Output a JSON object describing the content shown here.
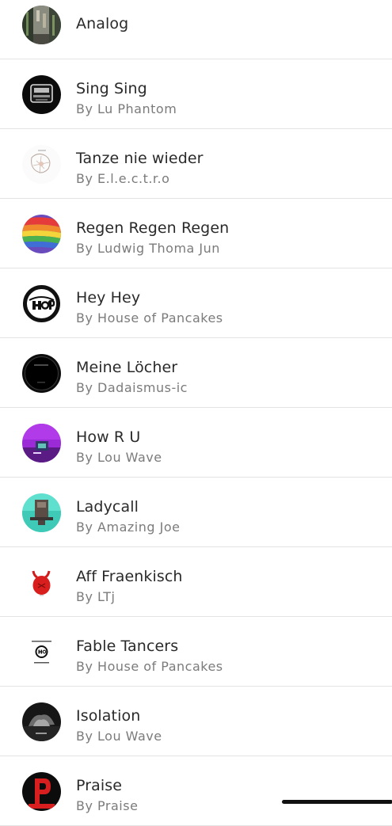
{
  "songs": [
    {
      "title": "Analog",
      "artist": "",
      "art": "photo-street-icon"
    },
    {
      "title": "Sing Sing",
      "artist": "By Lu Phantom",
      "art": "black-logo-icon"
    },
    {
      "title": "Tanze nie wieder",
      "artist": "By E.l.e.c.t.r.o",
      "art": "sketch-icon"
    },
    {
      "title": "Regen Regen Regen",
      "artist": "By Ludwig Thoma Jun",
      "art": "rainbow-flag-icon"
    },
    {
      "title": "Hey Hey",
      "artist": "By House of Pancakes",
      "art": "hop-logo-icon"
    },
    {
      "title": "Meine Löcher",
      "artist": "By Dadaismus-ic",
      "art": "black-disc-icon"
    },
    {
      "title": "How R U",
      "artist": "By Lou Wave",
      "art": "purple-cover-icon"
    },
    {
      "title": "Ladycall",
      "artist": "By Amazing Joe",
      "art": "teal-cover-icon"
    },
    {
      "title": "Aff Fraenkisch",
      "artist": "By LTj",
      "art": "red-devil-icon"
    },
    {
      "title": "Fable Tancers",
      "artist": "By House of Pancakes",
      "art": "hop-small-icon"
    },
    {
      "title": "Isolation",
      "artist": "By Lou Wave",
      "art": "dark-photo-icon"
    },
    {
      "title": "Praise",
      "artist": "By Praise",
      "art": "praise-logo-icon"
    }
  ]
}
